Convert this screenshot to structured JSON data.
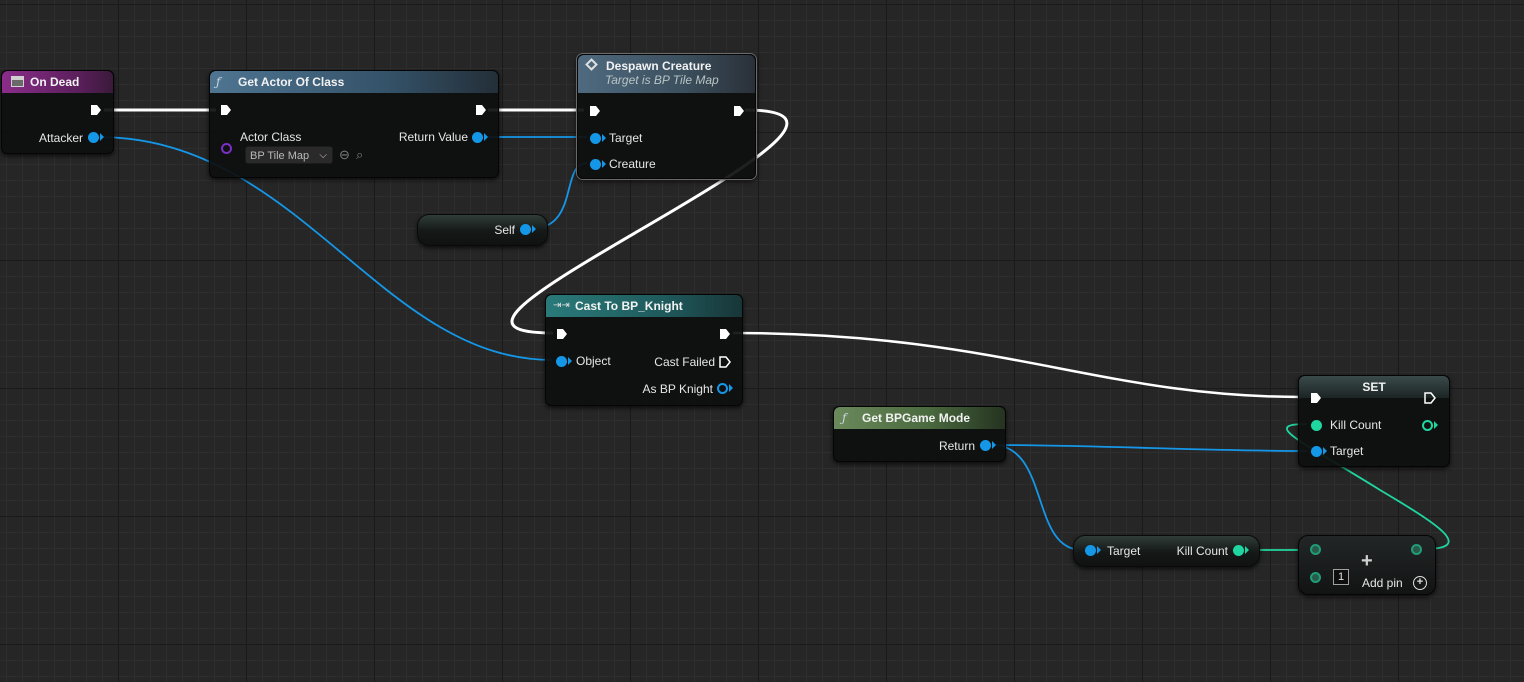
{
  "colors": {
    "exec_wire": "#ffffff",
    "object_pin": "#1597e8",
    "integer_pin": "#20d6a0",
    "class_pin": "#7a2fc8",
    "event_header": "#7a2a7a",
    "function_header": "#3a5a72",
    "cast_header": "#1f5f60",
    "pure_header": "#4b6a3f"
  },
  "nodes": {
    "on_dead": {
      "title": "On Dead",
      "icon": "event-node-icon",
      "pin_attacker": "Attacker"
    },
    "get_actor": {
      "title": "Get Actor Of Class",
      "icon": "function-icon",
      "pin_actor_class": "Actor Class",
      "class_value": "BP Tile Map",
      "pin_return": "Return Value"
    },
    "despawn": {
      "title": "Despawn Creature",
      "subtitle": "Target is BP Tile Map",
      "icon": "message-icon",
      "pin_target": "Target",
      "pin_creature": "Creature"
    },
    "self": {
      "label": "Self"
    },
    "cast": {
      "title": "Cast To BP_Knight",
      "icon": "cast-icon",
      "pin_object": "Object",
      "pin_cast_failed": "Cast Failed",
      "pin_as": "As BP Knight"
    },
    "get_gamemode": {
      "title": "Get BPGame Mode",
      "icon": "function-icon",
      "pin_return": "Return"
    },
    "set": {
      "title": "SET",
      "pin_kill_count": "Kill Count",
      "pin_target": "Target"
    },
    "get_killcount": {
      "pin_target": "Target",
      "pin_kill_count": "Kill Count"
    },
    "add": {
      "symbol": "+",
      "value": "1",
      "add_pin": "Add pin"
    }
  }
}
